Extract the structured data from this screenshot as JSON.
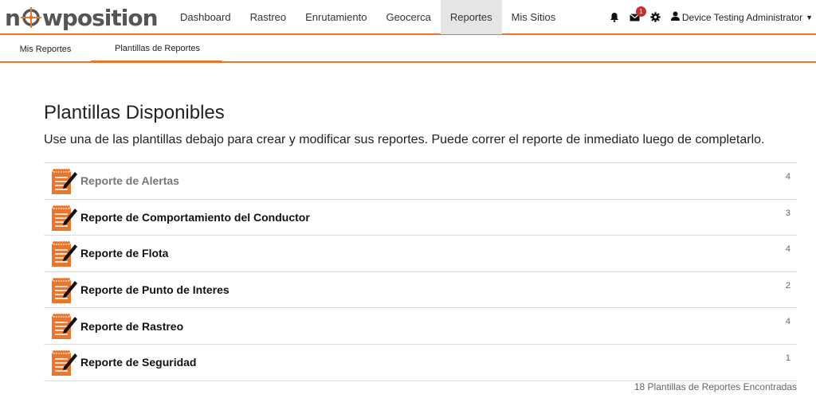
{
  "brand": {
    "logo_text_before": "n",
    "logo_text_after": "wposition"
  },
  "nav": {
    "items": [
      {
        "label": "Dashboard",
        "active": false
      },
      {
        "label": "Rastreo",
        "active": false
      },
      {
        "label": "Enrutamiento",
        "active": false
      },
      {
        "label": "Geocerca",
        "active": false
      },
      {
        "label": "Reportes",
        "active": true
      },
      {
        "label": "Mis Sitios",
        "active": false
      }
    ],
    "notifications_icon": "bell-icon",
    "messages_icon": "envelope-icon",
    "messages_badge": "1",
    "settings_icon": "gear-icon",
    "user_icon": "user-icon",
    "user_name": "Device Testing Administrator"
  },
  "subnav": {
    "tabs": [
      {
        "label": "Mis Reportes",
        "active": false
      },
      {
        "label": "Plantillas de Reportes",
        "active": true
      }
    ]
  },
  "main": {
    "title": "Plantillas Disponibles",
    "description": "Use una de las plantillas debajo para crear y modificar sus reportes. Puede correr el reporte de inmediato luego de completarlo.",
    "templates": [
      {
        "label": "Reporte de Alertas",
        "count": "4"
      },
      {
        "label": "Reporte de Comportamiento del Conductor",
        "count": "3"
      },
      {
        "label": "Reporte de Flota",
        "count": "4"
      },
      {
        "label": "Reporte de Punto de Interes",
        "count": "2"
      },
      {
        "label": "Reporte de Rastreo",
        "count": "4"
      },
      {
        "label": "Reporte de Seguridad",
        "count": "1"
      }
    ],
    "footer": "18 Plantillas de Reportes Encontradas"
  },
  "colors": {
    "accent": "#e8762c",
    "badge": "#c9302c"
  }
}
